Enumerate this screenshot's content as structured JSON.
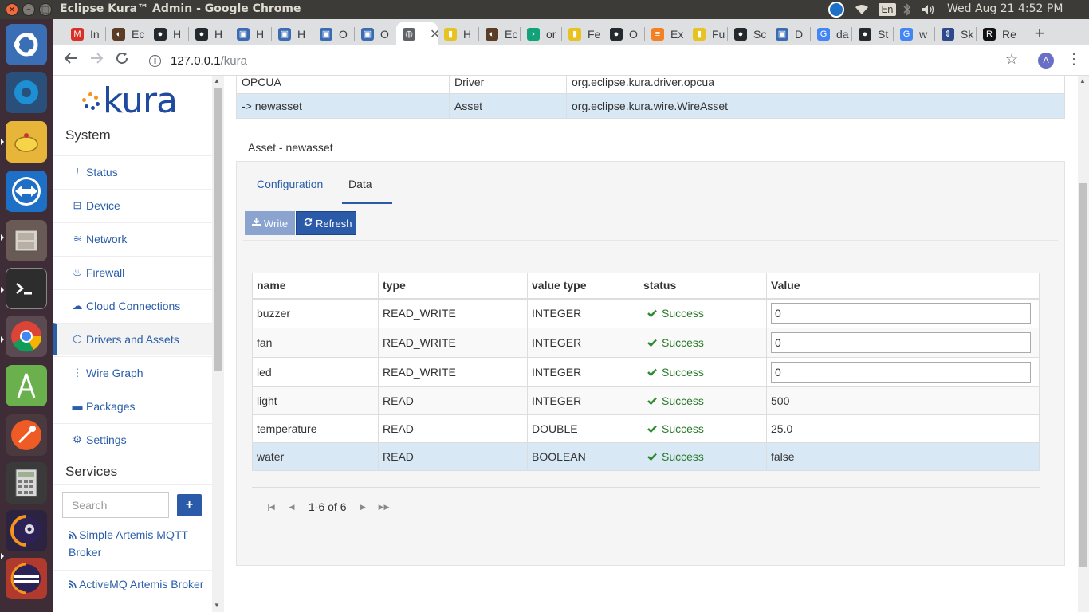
{
  "window": {
    "title": "Eclipse Kura™ Admin - Google Chrome",
    "controls": {
      "close": "×",
      "minimize": "–",
      "maximize": "□"
    }
  },
  "system_tray": {
    "keyboard_layout": "En",
    "clock": "Wed Aug 21  4:52 PM"
  },
  "browser": {
    "tabs": [
      {
        "label": "In",
        "icon": "gmail-icon",
        "color": "#d93025"
      },
      {
        "label": "Ec",
        "icon": "eclipse-icon",
        "color": "#5b3c27"
      },
      {
        "label": "H",
        "icon": "github-icon",
        "color": "#24292e"
      },
      {
        "label": "H",
        "icon": "github-icon",
        "color": "#24292e"
      },
      {
        "label": "H",
        "icon": "page-icon",
        "color": "#3b6bb3"
      },
      {
        "label": "H",
        "icon": "page-icon",
        "color": "#3b6bb3"
      },
      {
        "label": "O",
        "icon": "page-icon",
        "color": "#3b6bb3"
      },
      {
        "label": "O",
        "icon": "page-icon",
        "color": "#3b6bb3"
      },
      {
        "label": "",
        "icon": "globe-icon",
        "color": "#5f6368"
      },
      {
        "label": "H",
        "icon": "doc-icon",
        "color": "#e8c21e"
      },
      {
        "label": "Ec",
        "icon": "eclipse-icon",
        "color": "#5b3c27"
      },
      {
        "label": "or",
        "icon": "terminal-icon",
        "color": "#11a27a"
      },
      {
        "label": "Fe",
        "icon": "doc-icon",
        "color": "#e8c21e"
      },
      {
        "label": "O",
        "icon": "github-icon",
        "color": "#24292e"
      },
      {
        "label": "Ex",
        "icon": "stackoverflow-icon",
        "color": "#f48024"
      },
      {
        "label": "Fu",
        "icon": "doc-icon",
        "color": "#e8c21e"
      },
      {
        "label": "Sc",
        "icon": "github-icon",
        "color": "#24292e"
      },
      {
        "label": "D",
        "icon": "page-icon",
        "color": "#3b6bb3"
      },
      {
        "label": "da",
        "icon": "google-icon",
        "color": "#4285f4"
      },
      {
        "label": "St",
        "icon": "github-icon",
        "color": "#24292e"
      },
      {
        "label": "w",
        "icon": "google-icon",
        "color": "#4285f4"
      },
      {
        "label": "Sk",
        "icon": "arrows-icon",
        "color": "#2d4b8c"
      },
      {
        "label": "Re",
        "icon": "resharper-icon",
        "color": "#111111"
      }
    ],
    "active_tab_index": 8,
    "new_tab": "+",
    "url_host": "127.0.0.1",
    "url_path": "/kura",
    "profile_initial": "A"
  },
  "sidebar": {
    "logo_text": "kura",
    "system_title": "System",
    "nav": [
      {
        "label": "Status",
        "icon": "exclamation-icon",
        "glyph": "!"
      },
      {
        "label": "Device",
        "icon": "hdd-icon",
        "glyph": "⊟"
      },
      {
        "label": "Network",
        "icon": "wifi-icon",
        "glyph": "≋"
      },
      {
        "label": "Firewall",
        "icon": "fire-icon",
        "glyph": "♨"
      },
      {
        "label": "Cloud Connections",
        "icon": "cloud-icon",
        "glyph": "☁"
      },
      {
        "label": "Drivers and Assets",
        "icon": "cube-icon",
        "glyph": "⬡"
      },
      {
        "label": "Wire Graph",
        "icon": "sitemap-icon",
        "glyph": "⋮"
      },
      {
        "label": "Packages",
        "icon": "briefcase-icon",
        "glyph": "▬"
      },
      {
        "label": "Settings",
        "icon": "gear-icon",
        "glyph": "⚙"
      }
    ],
    "active_nav": "Drivers and Assets",
    "services_title": "Services",
    "search_placeholder": "Search",
    "add_label": "+",
    "services": [
      {
        "label": "Simple Artemis MQTT Broker"
      },
      {
        "label": "ActiveMQ Artemis Broker"
      }
    ]
  },
  "assets": {
    "rows": [
      {
        "name": "OPCUA",
        "type": "Driver",
        "factory": "org.eclipse.kura.driver.opcua"
      },
      {
        "name": "-> newasset",
        "type": "Asset",
        "factory": "org.eclipse.kura.wire.WireAsset"
      }
    ],
    "selected_row": 1
  },
  "asset_detail": {
    "heading": "Asset - newasset",
    "tabs": [
      "Configuration",
      "Data"
    ],
    "active_tab": "Data",
    "write_label": "Write",
    "refresh_label": "Refresh",
    "columns": [
      "name",
      "type",
      "value type",
      "status",
      "Value"
    ],
    "channels": [
      {
        "name": "buzzer",
        "type": "READ_WRITE",
        "value_type": "INTEGER",
        "status": "Success",
        "value": "0",
        "editable": true
      },
      {
        "name": "fan",
        "type": "READ_WRITE",
        "value_type": "INTEGER",
        "status": "Success",
        "value": "0",
        "editable": true
      },
      {
        "name": "led",
        "type": "READ_WRITE",
        "value_type": "INTEGER",
        "status": "Success",
        "value": "0",
        "editable": true
      },
      {
        "name": "light",
        "type": "READ",
        "value_type": "INTEGER",
        "status": "Success",
        "value": "500",
        "editable": false
      },
      {
        "name": "temperature",
        "type": "READ",
        "value_type": "DOUBLE",
        "status": "Success",
        "value": "25.0",
        "editable": false
      },
      {
        "name": "water",
        "type": "READ",
        "value_type": "BOOLEAN",
        "status": "Success",
        "value": "false",
        "editable": false
      }
    ],
    "selected_channel": 5,
    "pager_text": "1-6 of 6"
  },
  "colors": {
    "accent": "#2b5aa8",
    "link": "#2a5ea8",
    "success": "#2e8b2e",
    "selected_row": "#d9e8f5"
  }
}
